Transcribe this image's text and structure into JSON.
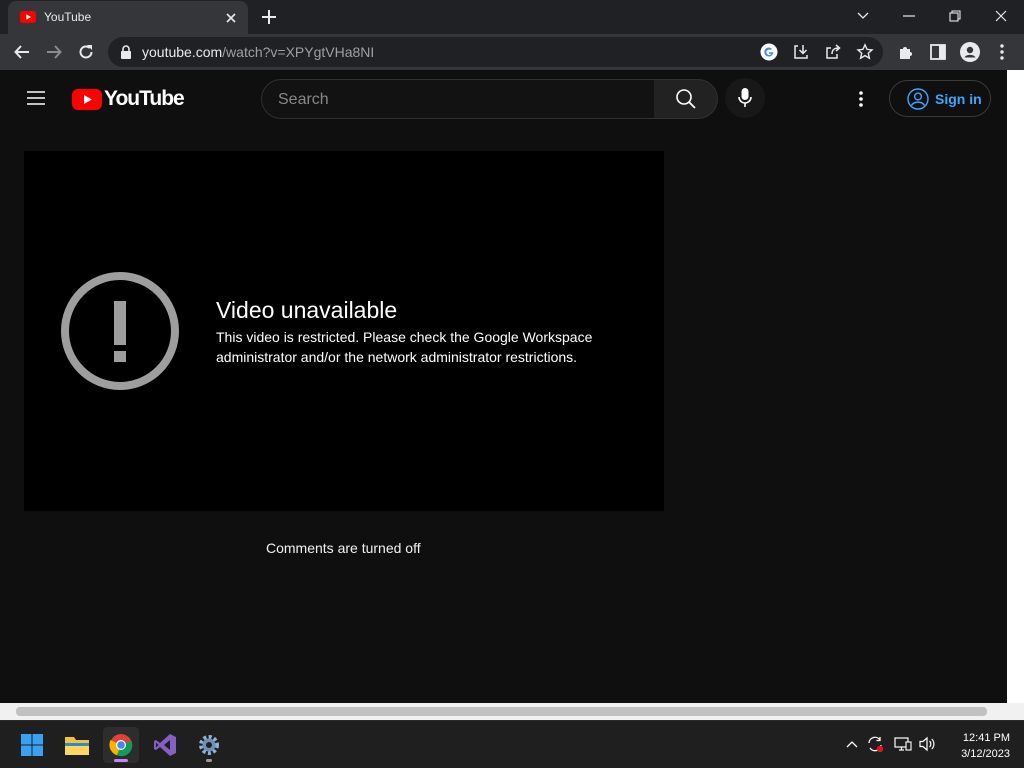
{
  "browser": {
    "tab_title": "YouTube",
    "url_host": "youtube.com",
    "url_path": "/watch?v=XPYgtVHa8NI"
  },
  "youtube": {
    "logo_text": "YouTube",
    "search_placeholder": "Search",
    "signin_label": "Sign in",
    "error_title": "Video unavailable",
    "error_message": "This video is restricted. Please check the Google Workspace administrator and/or the network administrator restrictions.",
    "comments_status": "Comments are turned off"
  },
  "taskbar": {
    "time": "12:41 PM",
    "date": "3/12/2023"
  },
  "colors": {
    "yt_red": "#ff0000",
    "link_blue": "#3ea6ff",
    "chrome_dark": "#202124",
    "chrome_toolbar": "#35363a"
  },
  "icons": [
    "youtube-favicon",
    "close-icon",
    "plus-icon",
    "chevron-down-icon",
    "minimize-icon",
    "restore-icon",
    "window-close-icon",
    "back-arrow-icon",
    "forward-arrow-icon",
    "reload-icon",
    "lock-icon",
    "google-icon",
    "install-icon",
    "share-icon",
    "star-icon",
    "extensions-icon",
    "side-panel-icon",
    "profile-icon",
    "kebab-menu-icon",
    "hamburger-icon",
    "youtube-logo-icon",
    "search-icon",
    "mic-icon",
    "account-icon",
    "exclamation-circle-icon",
    "windows-start-icon",
    "file-explorer-icon",
    "chrome-icon",
    "visual-studio-icon",
    "settings-icon",
    "chevron-up-icon",
    "sync-icon",
    "network-icon",
    "volume-icon"
  ]
}
